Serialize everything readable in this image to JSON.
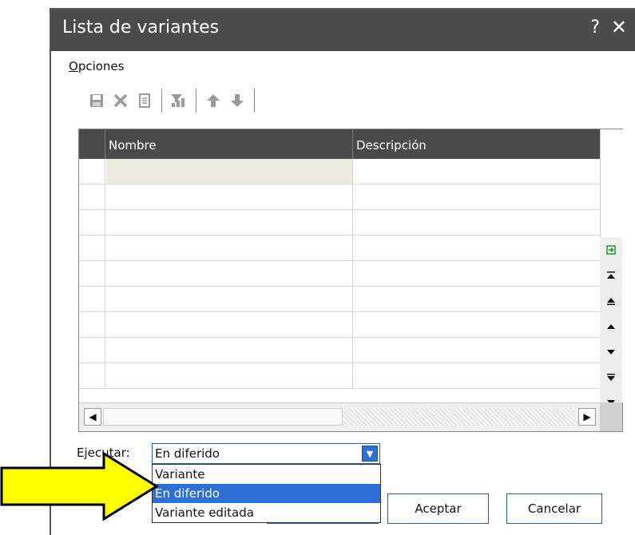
{
  "window": {
    "title": "Lista de variantes",
    "help_label": "?",
    "close_label": "✕"
  },
  "menu": {
    "options_label_underlined": "O",
    "options_label_rest": "pciones"
  },
  "toolbar": {
    "icons": [
      "save-icon",
      "delete-icon",
      "document-icon",
      "filter-icon",
      "move-up-icon",
      "move-down-icon"
    ]
  },
  "grid": {
    "columns": [
      "Nombre",
      "Descripción"
    ],
    "rows": [
      [
        "",
        ""
      ],
      [
        "",
        ""
      ],
      [
        "",
        ""
      ],
      [
        "",
        ""
      ],
      [
        "",
        ""
      ],
      [
        "",
        ""
      ],
      [
        "",
        ""
      ],
      [
        "",
        ""
      ],
      [
        "",
        ""
      ]
    ],
    "side_buttons": [
      "export-icon",
      "first-page-icon",
      "page-up-icon",
      "row-up-icon",
      "row-down-icon",
      "page-down-icon",
      "last-page-icon"
    ]
  },
  "execute": {
    "label": "Ejecutar:",
    "selected": "En diferido",
    "options": [
      "Variante",
      "En diferido",
      "Variante editada"
    ]
  },
  "buttons": {
    "accept": "Aceptar",
    "cancel": "Cancelar"
  },
  "colors": {
    "title_bar": "#4b4b4b",
    "highlight": "#2d6fd6",
    "arrow_fill": "#ffff00"
  }
}
